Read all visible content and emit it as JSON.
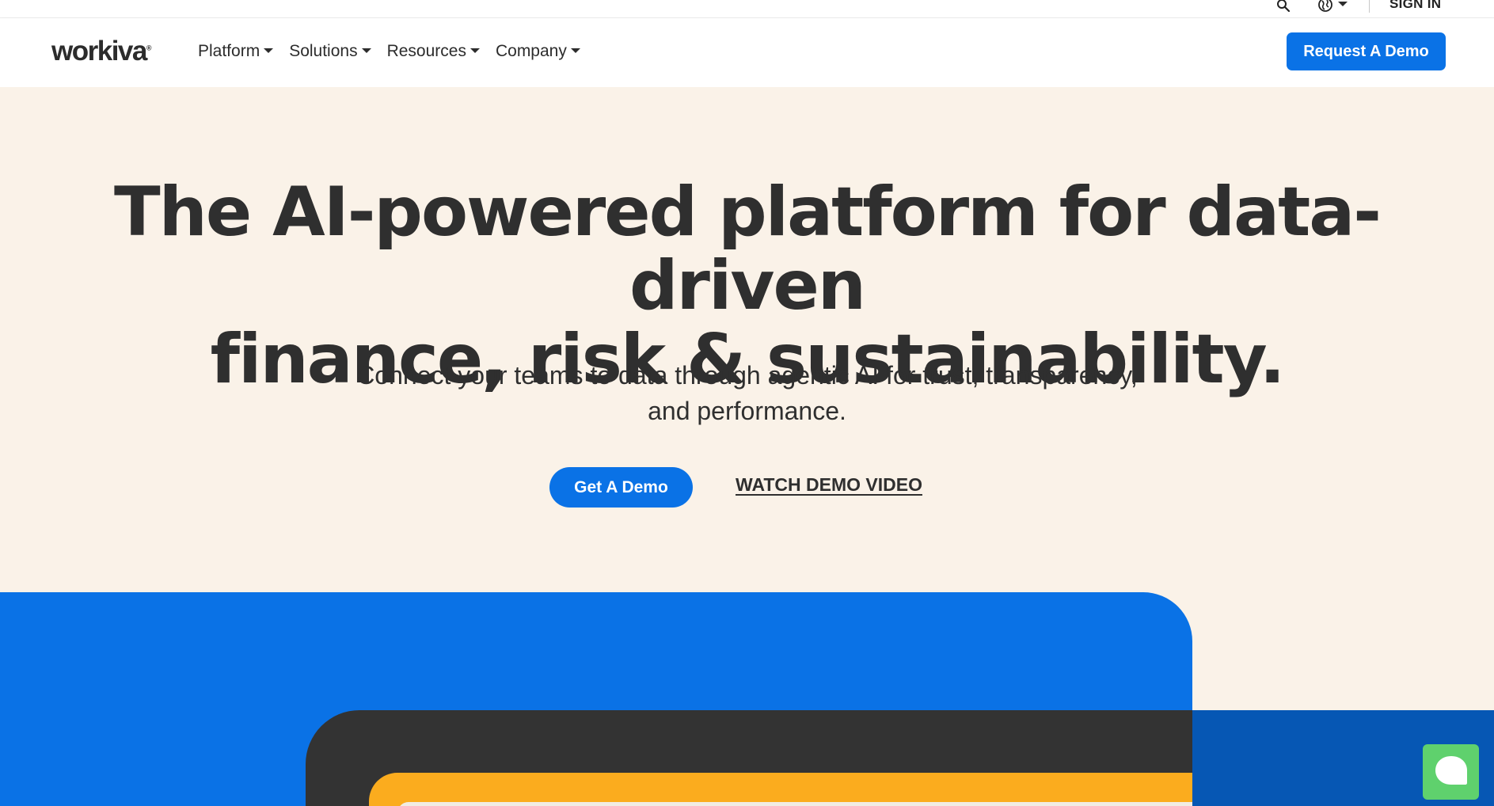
{
  "utility": {
    "search_icon": "search-icon",
    "globe_icon": "globe-icon",
    "signin_label": "SIGN IN"
  },
  "nav": {
    "logo_text": "workiva",
    "logo_mark": "®",
    "items": [
      {
        "label": "Platform"
      },
      {
        "label": "Solutions"
      },
      {
        "label": "Resources"
      },
      {
        "label": "Company"
      }
    ],
    "cta_label": "Request A Demo"
  },
  "hero": {
    "title_line1": "The AI-powered platform for data-driven",
    "title_line2": "finance, risk & sustainability.",
    "subtitle_line1": "Connect your teams to data through agentic AI for trust, transparency,",
    "subtitle_line2": "and performance.",
    "primary_cta": "Get A Demo",
    "secondary_cta": "WATCH DEMO VIDEO"
  },
  "chat": {
    "icon": "chat-bubble-icon"
  },
  "colors": {
    "brand_blue": "#0a72e6",
    "dark_blue": "#0657b4",
    "hero_bg": "#faf2e8",
    "dark": "#333333",
    "yellow": "#fbac1e",
    "chat_green": "#5fd16d"
  }
}
